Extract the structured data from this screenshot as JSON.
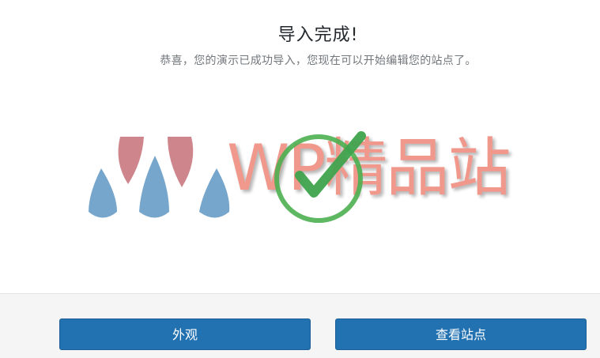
{
  "header": {
    "title": "导入完成!",
    "subtitle": "恭喜，您的演示已成功导入，您现在可以开始编辑您的站点了。"
  },
  "watermark": {
    "text": "WP精品站"
  },
  "footer": {
    "appearance_label": "外观",
    "view_site_label": "查看站点"
  },
  "colors": {
    "button": "#2271b1",
    "success": "#4caf50",
    "watermark_text": "#f08a7e"
  },
  "icons": {
    "success": "checkmark-circle-icon",
    "logo": "wp-logo-icon"
  }
}
